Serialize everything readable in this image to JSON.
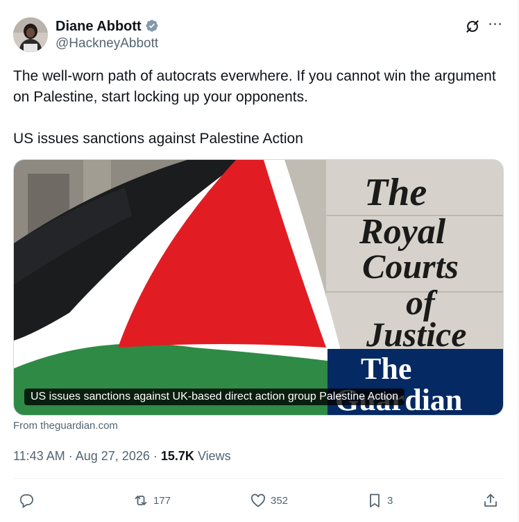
{
  "author": {
    "name": "Diane Abbott",
    "handle": "@HackneyAbbott",
    "verified": true,
    "badge_color": "#829aab"
  },
  "tweet": {
    "paragraph_1": "The well-worn path of autocrats everwhere. If you cannot win the argument on Palestine, start locking up your opponents.",
    "paragraph_2": "US issues sanctions against Palestine Action"
  },
  "card": {
    "caption": "US issues sanctions against UK-based direct action group Palestine Action",
    "source": "From theguardian.com",
    "image_sign_text": [
      "The",
      "Royal",
      "Courts",
      "of",
      "Justice"
    ],
    "logo_text": [
      "The",
      "Guardian"
    ],
    "logo_color": "#052962"
  },
  "meta": {
    "time": "11:43 AM",
    "separator": "·",
    "date": "Aug 27, 2026",
    "views_count": "15.7K",
    "views_label": "Views"
  },
  "actions": {
    "replies": "",
    "retweets": "177",
    "likes": "352",
    "bookmarks": "3"
  },
  "icons": [
    "verified-badge-icon",
    "grok-icon",
    "more-icon",
    "reply-icon",
    "retweet-icon",
    "like-icon",
    "bookmark-icon",
    "share-icon"
  ],
  "colors": {
    "text": "#0f1419",
    "secondary": "#536471",
    "border": "#cfd9de"
  }
}
